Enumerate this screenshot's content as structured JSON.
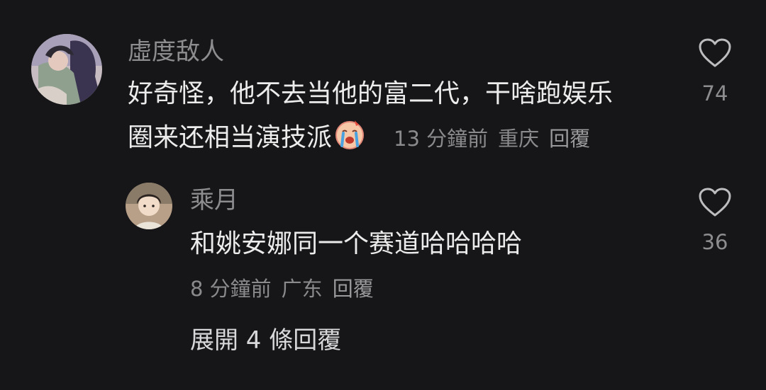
{
  "comment": {
    "username": "虛度敌人",
    "text_line1": "好奇怪，他不去当他的富二代，干啥跑娱乐",
    "text_line2": "圈来还相当演技派",
    "emoji": "crying-face-emoji",
    "time": "13 分鐘前",
    "location": "重庆",
    "reply_label": "回覆",
    "likes": "74"
  },
  "reply": {
    "username": "乘月",
    "text": "和姚安娜同一个赛道哈哈哈哈",
    "time": "8 分鐘前",
    "location": "广东",
    "reply_label": "回覆",
    "likes": "36"
  },
  "expand_label": "展開 4 條回覆",
  "colors": {
    "background": "#161618",
    "text": "#ececec",
    "secondary": "#8d8d90"
  }
}
